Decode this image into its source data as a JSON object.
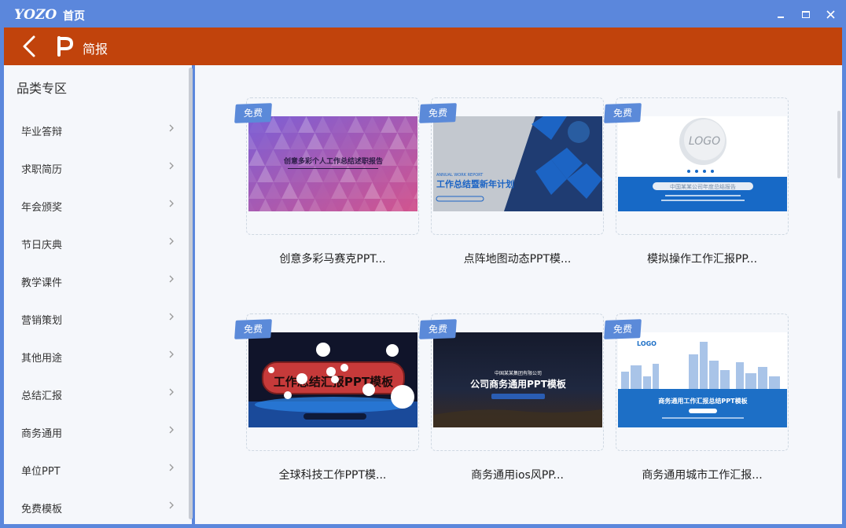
{
  "titlebar": {
    "logo": "YOZO",
    "title": "首页"
  },
  "header": {
    "title": "简报"
  },
  "sidebar": {
    "heading": "品类专区",
    "items": [
      {
        "label": "毕业答辩"
      },
      {
        "label": "求职简历"
      },
      {
        "label": "年会颁奖"
      },
      {
        "label": "节日庆典"
      },
      {
        "label": "教学课件"
      },
      {
        "label": "营销策划"
      },
      {
        "label": "其他用途"
      },
      {
        "label": "总结汇报"
      },
      {
        "label": "商务通用"
      },
      {
        "label": "单位PPT"
      },
      {
        "label": "免费模板"
      }
    ]
  },
  "templates": [
    {
      "tag": "免费",
      "caption": "创意多彩马赛克PPT...",
      "thumb_title": "创意多彩个人工作总结述职报告",
      "thumb_colors": [
        "#7b5fd6",
        "#d2548e"
      ]
    },
    {
      "tag": "免费",
      "caption": "点阵地图动态PPT模...",
      "thumb_title": "工作总结暨新年计划",
      "thumb_sub": "ANNUAL WORK REPORT",
      "thumb_colors": [
        "#c3c8cf",
        "#1c64c4"
      ]
    },
    {
      "tag": "免费",
      "caption": "模拟操作工作汇报PP...",
      "thumb_title": "中国某某公司年度总结报告",
      "thumb_logo": "LOGO",
      "thumb_colors": [
        "#ffffff",
        "#1769c6"
      ]
    },
    {
      "tag": "免费",
      "caption": "全球科技工作PPT模...",
      "thumb_title": "工作总结汇报PPT模板",
      "thumb_colors": [
        "#10142a",
        "#c63a3a"
      ]
    },
    {
      "tag": "免费",
      "caption": "商务通用ios风PP...",
      "thumb_title": "公司商务通用PPT模板",
      "thumb_sub": "中国某某集团有限公司",
      "thumb_colors": [
        "#151a2c",
        "#2a5db3"
      ]
    },
    {
      "tag": "免费",
      "caption": "商务通用城市工作汇报...",
      "thumb_title": "商务通用工作汇报总结PPT模板",
      "thumb_logo": "LOGO",
      "thumb_colors": [
        "#ffffff",
        "#1d6fc6"
      ]
    }
  ],
  "colors": {
    "titlebar": "#5b87dc",
    "header": "#c1430c",
    "panel": "#f5f7fb",
    "tag": "#5b8ad9"
  }
}
